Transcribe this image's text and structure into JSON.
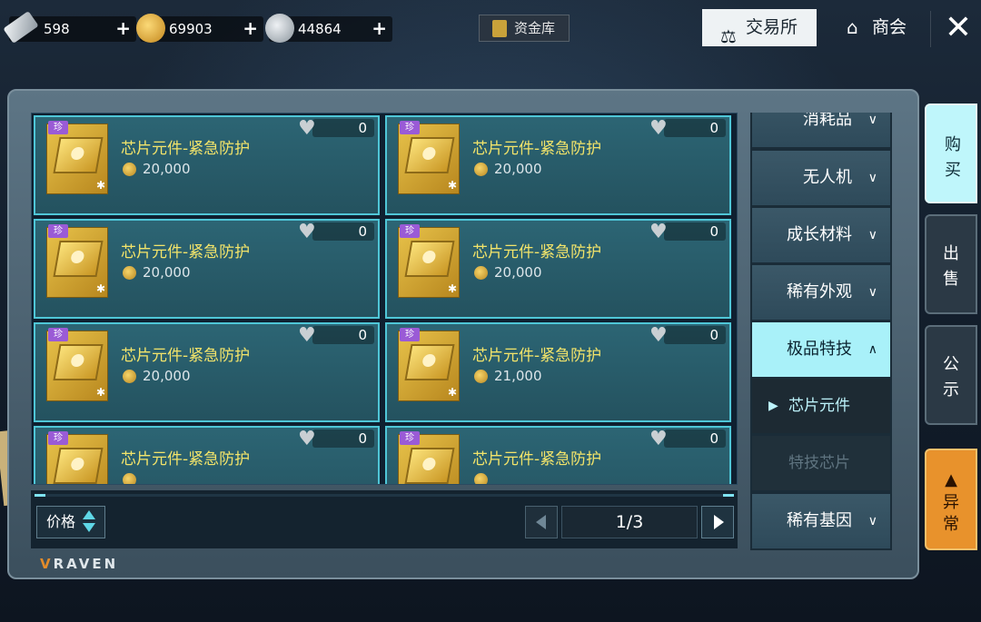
{
  "currencies": [
    {
      "value": "598",
      "icon": "silver-bar-icon",
      "color": "#c9d0d6"
    },
    {
      "value": "69903",
      "icon": "gold-coin-icon",
      "color": "#e0a72a"
    },
    {
      "value": "44864",
      "icon": "silver-coin-icon",
      "color": "#c8ccd2"
    }
  ],
  "header": {
    "vault_label": "资金库",
    "exchange_label": "交易所",
    "guild_label": "商会",
    "exchange_icon": "scale-icon",
    "guild_icon": "house-icon",
    "close_icon": "close-icon"
  },
  "items": [
    {
      "name": "芯片元件-紧急防护",
      "price": "20,000",
      "favorites": "0",
      "rarity": "珍"
    },
    {
      "name": "芯片元件-紧急防护",
      "price": "20,000",
      "favorites": "0",
      "rarity": "珍"
    },
    {
      "name": "芯片元件-紧急防护",
      "price": "20,000",
      "favorites": "0",
      "rarity": "珍"
    },
    {
      "name": "芯片元件-紧急防护",
      "price": "20,000",
      "favorites": "0",
      "rarity": "珍"
    },
    {
      "name": "芯片元件-紧急防护",
      "price": "20,000",
      "favorites": "0",
      "rarity": "珍"
    },
    {
      "name": "芯片元件-紧急防护",
      "price": "21,000",
      "favorites": "0",
      "rarity": "珍"
    },
    {
      "name": "芯片元件-紧急防护",
      "price": "",
      "favorites": "0",
      "rarity": "珍"
    },
    {
      "name": "芯片元件-紧急防护",
      "price": "",
      "favorites": "0",
      "rarity": "珍"
    }
  ],
  "footer": {
    "sort_label": "价格",
    "page": "1/3",
    "brand": "RAVEN"
  },
  "categories": [
    {
      "label": "消耗品",
      "state": "collapsed"
    },
    {
      "label": "无人机",
      "state": "collapsed"
    },
    {
      "label": "成长材料",
      "state": "collapsed"
    },
    {
      "label": "稀有外观",
      "state": "collapsed"
    },
    {
      "label": "极品特技",
      "state": "expanded"
    },
    {
      "label": "芯片元件",
      "state": "sub-selected"
    },
    {
      "label": "特技芯片",
      "state": "sub"
    },
    {
      "label": "稀有基因",
      "state": "collapsed"
    }
  ],
  "side_tabs": {
    "buy": "购买",
    "sell": "出售",
    "notice": "公示",
    "abnormal": "异常"
  }
}
